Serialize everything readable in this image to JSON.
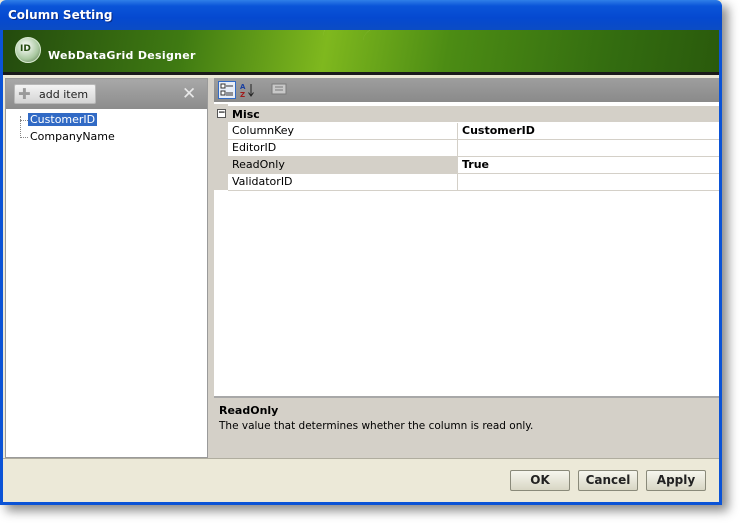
{
  "window": {
    "title": "Column Setting"
  },
  "banner": {
    "title": "WebDataGrid Designer",
    "icon": "designer-logo-icon"
  },
  "left": {
    "add_item_label": "add item",
    "items": [
      {
        "label": "CustomerID",
        "selected": true
      },
      {
        "label": "CompanyName",
        "selected": false
      }
    ]
  },
  "properties": {
    "category": "Misc",
    "rows": [
      {
        "name": "ColumnKey",
        "value": "CustomerID"
      },
      {
        "name": "EditorID",
        "value": ""
      },
      {
        "name": "ReadOnly",
        "value": "True"
      },
      {
        "name": "ValidatorID",
        "value": ""
      }
    ]
  },
  "description": {
    "title": "ReadOnly",
    "text": "The value that determines whether the column is read only."
  },
  "buttons": {
    "ok": "OK",
    "cancel": "Cancel",
    "apply": "Apply"
  },
  "colors": {
    "title_bar": "#0a54d8",
    "banner_green": "#3f7a12",
    "selection": "#316ac5"
  }
}
